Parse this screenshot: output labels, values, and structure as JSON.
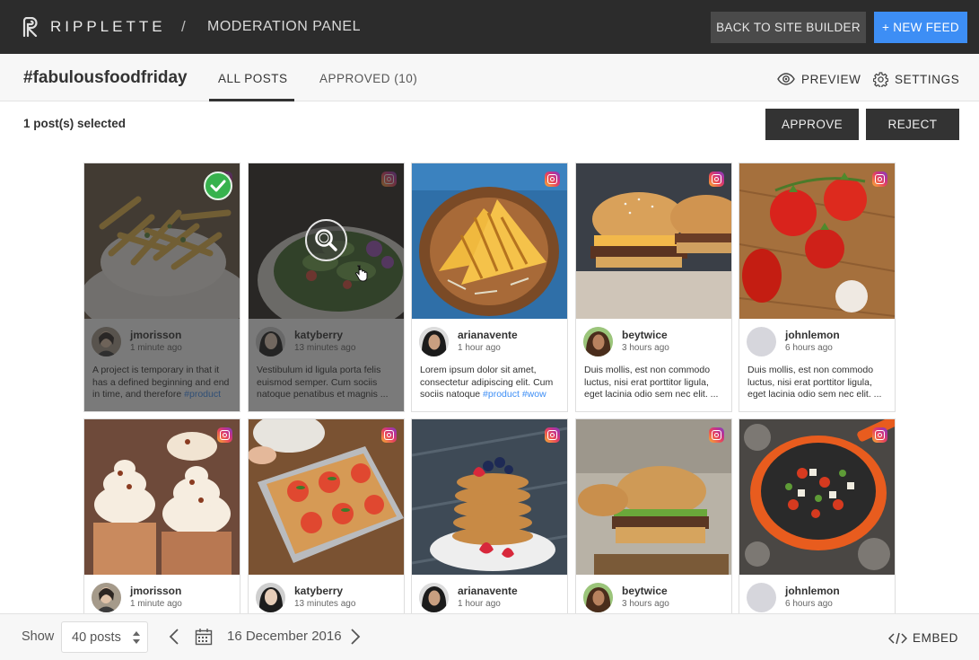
{
  "topbar": {
    "brand": "RIPPLETTE",
    "separator": "/",
    "title": "MODERATION PANEL",
    "back_label": "BACK TO SITE BUILDER",
    "new_feed_label": "+ NEW FEED",
    "accent": "#3d8ef5"
  },
  "subheader": {
    "hashtag": "#fabulousfoodfriday",
    "tabs": [
      {
        "label": "ALL POSTS",
        "active": true
      },
      {
        "label": "APPROVED (10)",
        "active": false
      }
    ],
    "preview_label": "PREVIEW",
    "settings_label": "SETTINGS"
  },
  "selection": {
    "count_text": "1 post(s) selected",
    "approve_label": "APPROVE",
    "reject_label": "REJECT"
  },
  "posts": [
    {
      "user": "jmorisson",
      "time": "1 minute ago",
      "caption": "A project is temporary in that it has a defined beginning and end in time, and therefore ",
      "tags": "#product",
      "image": "fries",
      "source": "instagram",
      "selected": true
    },
    {
      "user": "katyberry",
      "time": "13 minutes ago",
      "caption": "Vestibulum id ligula porta felis euismod semper. Cum sociis natoque penatibus et magnis ...",
      "tags": "",
      "image": "salad",
      "source": "instagram",
      "hovered": true
    },
    {
      "user": "arianavente",
      "time": "1 hour ago",
      "caption": "Lorem ipsum dolor sit amet, consectetur adipiscing elit. Cum sociis natoque ",
      "tags": "#product #wow",
      "image": "sandwich",
      "source": "instagram"
    },
    {
      "user": "beytwice",
      "time": "3 hours ago",
      "caption": "Duis mollis, est non commodo luctus, nisi erat porttitor ligula, eget lacinia odio sem nec elit. ...",
      "tags": "",
      "image": "burgers",
      "source": "instagram"
    },
    {
      "user": "johnlemon",
      "time": "6 hours ago",
      "caption": "Duis mollis, est non commodo luctus, nisi erat porttitor ligula, eget lacinia odio sem nec elit. ...",
      "tags": "",
      "image": "tomatoes",
      "source": "instagram"
    },
    {
      "user": "jmorisson",
      "time": "1 minute ago",
      "caption": "",
      "tags": "",
      "image": "cupcakes",
      "source": "instagram"
    },
    {
      "user": "katyberry",
      "time": "13 minutes ago",
      "caption": "",
      "tags": "",
      "image": "bruschetta",
      "source": "instagram"
    },
    {
      "user": "arianavente",
      "time": "1 hour ago",
      "caption": "",
      "tags": "",
      "image": "pancakes",
      "source": "instagram"
    },
    {
      "user": "beytwice",
      "time": "3 hours ago",
      "caption": "",
      "tags": "",
      "image": "burger",
      "source": "instagram"
    },
    {
      "user": "johnlemon",
      "time": "6 hours ago",
      "caption": "",
      "tags": "",
      "image": "pan",
      "source": "instagram"
    }
  ],
  "footer": {
    "show_label": "Show",
    "page_size": "40 posts",
    "date": "16 December 2016",
    "embed_label": "EMBED"
  }
}
